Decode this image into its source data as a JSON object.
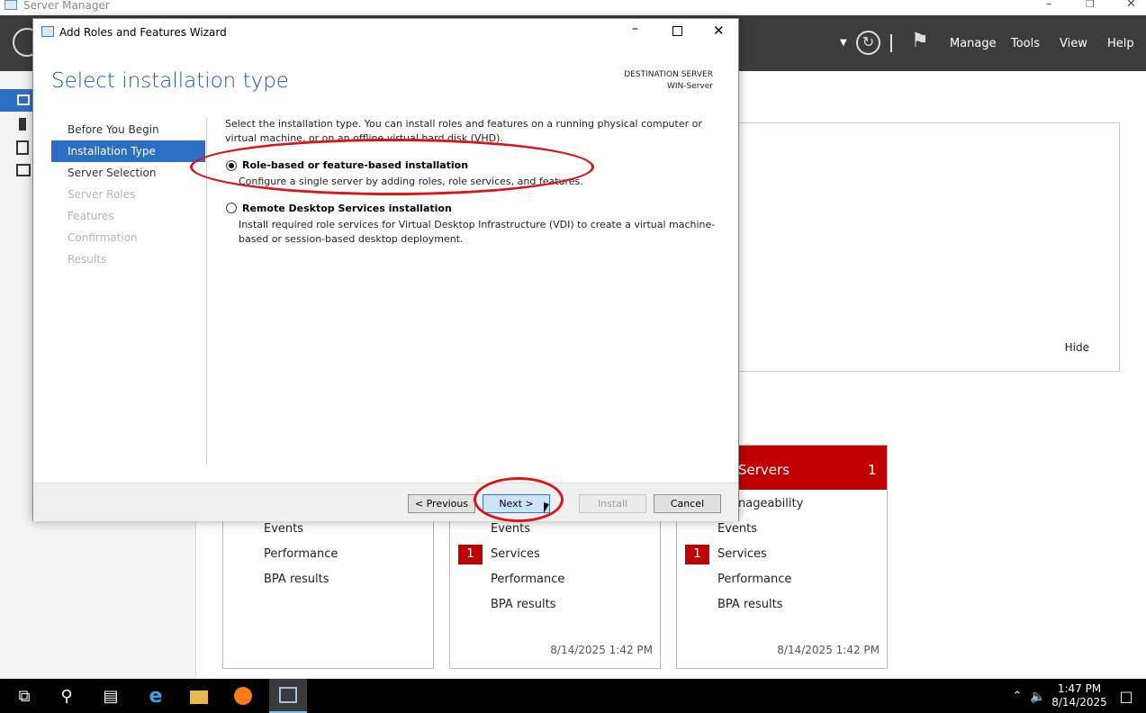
{
  "server_manager": {
    "title": "Server Manager",
    "menu": [
      "Manage",
      "Tools",
      "View",
      "Help"
    ],
    "welcome": {
      "hide_label": "Hide"
    },
    "tiles": [
      {
        "items": [
          "Events",
          "Performance",
          "BPA results"
        ]
      },
      {
        "items": [
          "Events",
          "Services",
          "Performance",
          "BPA results"
        ],
        "services_badge": "1",
        "timestamp": "8/14/2025 1:42 PM"
      },
      {
        "header": "Servers",
        "header_count": "1",
        "items": [
          "nageability",
          "Events",
          "Services",
          "Performance",
          "BPA results"
        ],
        "services_badge": "1",
        "timestamp": "8/14/2025 1:42 PM"
      }
    ]
  },
  "wizard": {
    "title": "Add Roles and Features Wizard",
    "heading": "Select installation type",
    "destination_label": "DESTINATION SERVER",
    "destination_value": "WIN-Server",
    "nav": [
      {
        "label": "Before You Begin",
        "state": "done"
      },
      {
        "label": "Installation Type",
        "state": "active"
      },
      {
        "label": "Server Selection",
        "state": "done"
      },
      {
        "label": "Server Roles",
        "state": "disabled"
      },
      {
        "label": "Features",
        "state": "disabled"
      },
      {
        "label": "Confirmation",
        "state": "disabled"
      },
      {
        "label": "Results",
        "state": "disabled"
      }
    ],
    "description": "Select the installation type. You can install roles and features on a running physical computer or virtual machine, or on an offline virtual hard disk (VHD).",
    "options": [
      {
        "title": "Role-based or feature-based installation",
        "desc": "Configure a single server by adding roles, role services, and features.",
        "selected": true
      },
      {
        "title": "Remote Desktop Services installation",
        "desc": "Install required role services for Virtual Desktop Infrastructure (VDI) to create a virtual machine-based or session-based desktop deployment.",
        "selected": false
      }
    ],
    "buttons": {
      "previous": "< Previous",
      "next": "Next >",
      "install": "Install",
      "cancel": "Cancel"
    }
  },
  "taskbar": {
    "time": "1:47 PM",
    "date": "8/14/2025"
  },
  "colors": {
    "accent": "#2c6ec4",
    "heading": "#1e5a96",
    "alert": "#c00000",
    "annotation": "#d8161c"
  }
}
